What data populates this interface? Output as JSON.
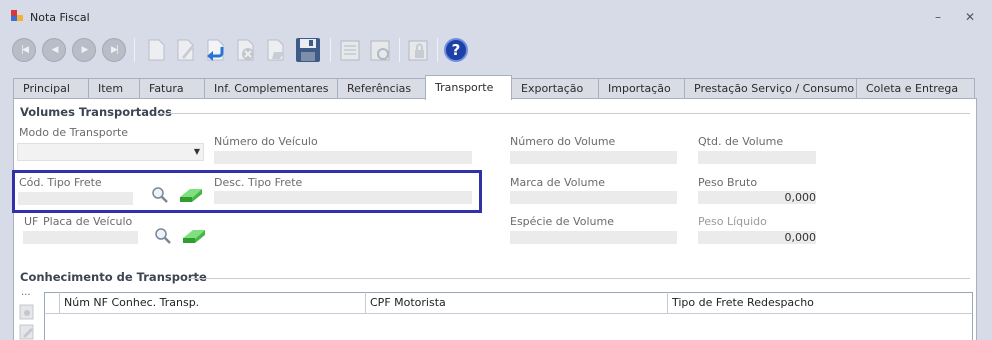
{
  "window": {
    "title": "Nota Fiscal",
    "minimize": "–",
    "close": "✕"
  },
  "toolbar": {
    "items": [
      "first-icon",
      "previous-icon",
      "next-icon",
      "last-icon",
      "new-icon",
      "edit-icon",
      "undo-icon",
      "cancel-icon",
      "delete-icon",
      "save-icon",
      "report-icon",
      "refresh-icon",
      "lock-icon",
      "help-icon"
    ],
    "help_label": "?"
  },
  "tabs": [
    {
      "label": "Principal"
    },
    {
      "label": "Item"
    },
    {
      "label": "Fatura"
    },
    {
      "label": "Inf. Complementares"
    },
    {
      "label": "Referências"
    },
    {
      "label": "Transporte",
      "active": true
    },
    {
      "label": "Exportação"
    },
    {
      "label": "Importação"
    },
    {
      "label": "Prestação Serviço / Consumo"
    },
    {
      "label": "Coleta e Entrega"
    }
  ],
  "volumes": {
    "group_title": "Volumes Transportados",
    "modo_transporte": {
      "label": "Modo de Transporte",
      "value": ""
    },
    "numero_veiculo": {
      "label": "Número do Veículo",
      "value": ""
    },
    "numero_volume": {
      "label": "Número do Volume",
      "value": ""
    },
    "qtd_volume": {
      "label": "Qtd. de Volume",
      "value": ""
    },
    "cod_tipo_frete": {
      "label": "Cód. Tipo Frete",
      "value": ""
    },
    "desc_tipo_frete": {
      "label": "Desc. Tipo Frete",
      "value": ""
    },
    "marca_volume": {
      "label": "Marca de Volume",
      "value": ""
    },
    "peso_bruto": {
      "label": "Peso Bruto",
      "value": "0,000"
    },
    "uf": {
      "label": "UF",
      "value": ""
    },
    "placa_veiculo": {
      "label": "Placa de Veículo",
      "value": ""
    },
    "especie_volume": {
      "label": "Espécie de Volume",
      "value": ""
    },
    "peso_liquido": {
      "label": "Peso Líquido",
      "value": "0,000"
    }
  },
  "conhecimento": {
    "group_title": "Conhecimento de Transporte",
    "more_label": "...",
    "columns": [
      "Núm NF Conhec. Transp.",
      "CPF Motorista",
      "Tipo de Frete Redespacho"
    ]
  },
  "colors": {
    "highlight": "#3232a8",
    "help": "#1d3fa8",
    "eraser": "#3cb83c"
  }
}
